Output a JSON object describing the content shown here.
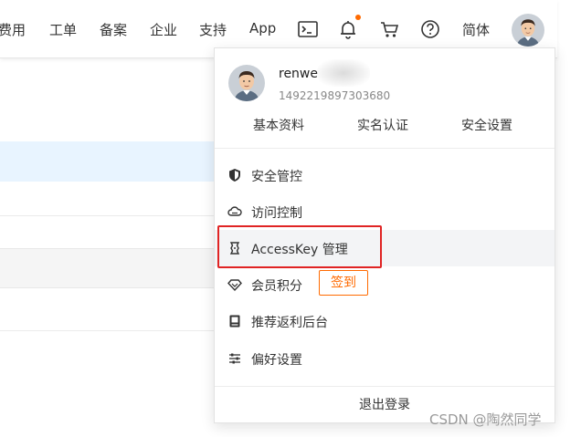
{
  "nav": {
    "items": [
      "费用",
      "工单",
      "备案",
      "企业",
      "支持",
      "App"
    ],
    "language": "简体",
    "icons": [
      "terminal-icon",
      "bell-icon",
      "cart-icon",
      "help-icon"
    ],
    "notification_dot_color": "#ff6a00"
  },
  "account": {
    "username_visible": "renwe",
    "account_id": "1492219897303680",
    "links": [
      "基本资料",
      "实名认证",
      "安全设置"
    ]
  },
  "menu": {
    "items": [
      {
        "label": "安全管控",
        "icon": "shield-icon"
      },
      {
        "label": "访问控制",
        "icon": "cloud-icon"
      },
      {
        "label": "AccessKey 管理",
        "icon": "key-icon"
      },
      {
        "label": "会员积分",
        "icon": "diamond-icon",
        "badge": "签到"
      },
      {
        "label": "推荐返利后台",
        "icon": "book-icon"
      },
      {
        "label": "偏好设置",
        "icon": "sliders-icon"
      }
    ],
    "logout": "退出登录"
  },
  "colors": {
    "accent": "#ff6a00",
    "highlight_box": "#e02424",
    "selected_row_bg": "#e8f4ff"
  },
  "watermark": "CSDN @陶然同学"
}
